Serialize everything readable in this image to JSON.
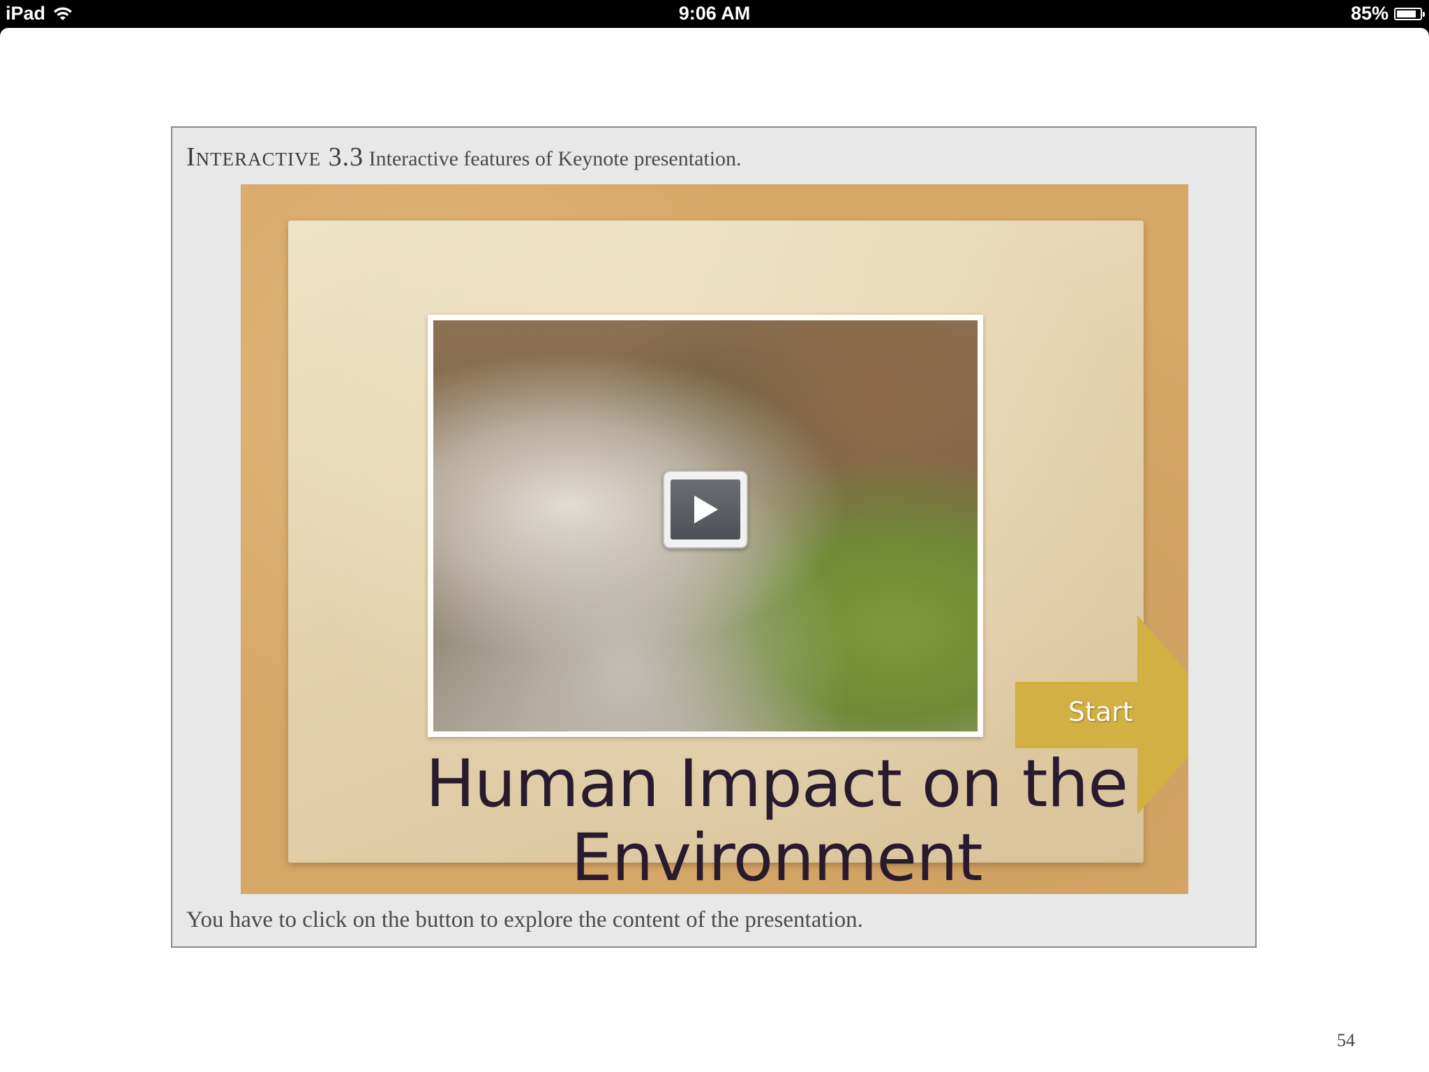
{
  "status_bar": {
    "device": "iPad",
    "time": "9:06 AM",
    "battery": "85%",
    "battery_level": 0.85
  },
  "figure": {
    "label": "Interactive 3.3",
    "caption": "Interactive features of Keynote presentation.",
    "footnote": "You have to click on the button to explore the content of the presentation."
  },
  "slide": {
    "title": "Human Impact on the Environment",
    "start_label": "Start",
    "start_color": "#d2b043",
    "video_icon": "play-icon"
  },
  "page": {
    "number": "54"
  }
}
